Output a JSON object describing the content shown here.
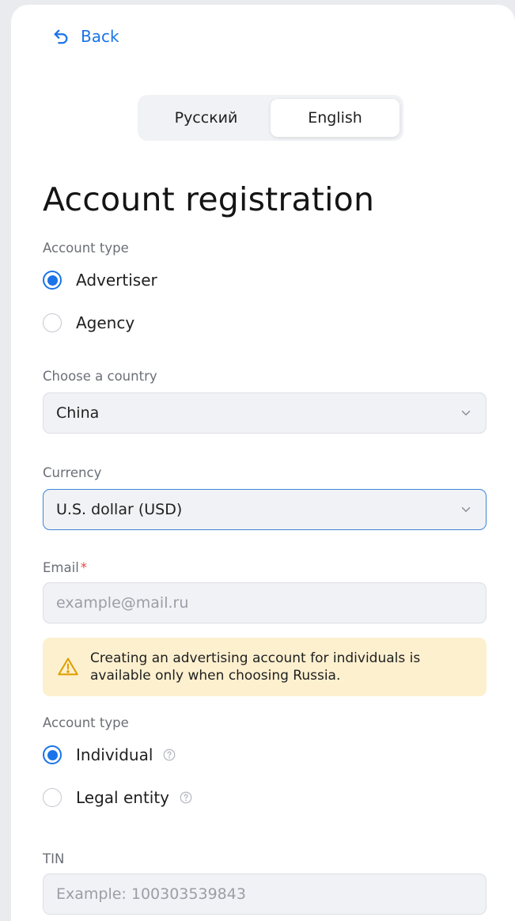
{
  "nav": {
    "back_label": "Back"
  },
  "language": {
    "options": [
      "Русский",
      "English"
    ],
    "selected": "English"
  },
  "page_title": "Account registration",
  "account_type": {
    "label": "Account type",
    "options": [
      {
        "label": "Advertiser",
        "checked": true
      },
      {
        "label": "Agency",
        "checked": false
      }
    ]
  },
  "country": {
    "label": "Choose a country",
    "value": "China"
  },
  "currency": {
    "label": "Currency",
    "value": "U.S. dollar (USD)"
  },
  "email": {
    "label": "Email",
    "required_mark": "*",
    "placeholder": "example@mail.ru",
    "value": ""
  },
  "notice": {
    "text": "Creating an advertising account for individuals is available only when choosing Russia."
  },
  "entity_type": {
    "label": "Account type",
    "options": [
      {
        "label": "Individual",
        "checked": true
      },
      {
        "label": "Legal entity",
        "checked": false
      }
    ]
  },
  "tin": {
    "label": "TIN",
    "placeholder": "Example: 100303539843",
    "value": ""
  },
  "colors": {
    "accent": "#1a73e8",
    "notice_bg": "#fdf0cf",
    "warning_icon": "#e0a000",
    "required": "#e64646"
  },
  "icons": {
    "back": "undo-arrow-icon",
    "dropdown": "chevron-down-icon",
    "warning": "warning-triangle-icon",
    "help": "question-circle-icon"
  }
}
